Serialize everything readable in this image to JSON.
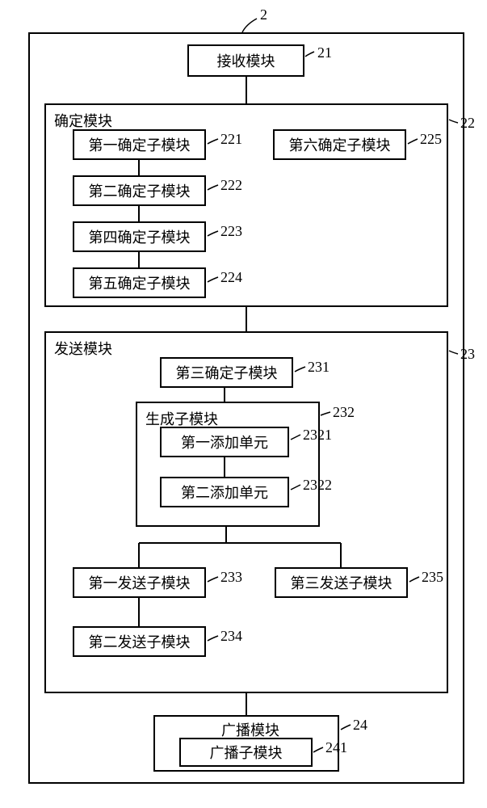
{
  "system": {
    "id": "2"
  },
  "receive": {
    "id": "21",
    "label": "接收模块"
  },
  "determine": {
    "id": "22",
    "title": "确定模块",
    "sub1": {
      "id": "221",
      "label": "第一确定子模块"
    },
    "sub2": {
      "id": "222",
      "label": "第二确定子模块"
    },
    "sub4": {
      "id": "223",
      "label": "第四确定子模块"
    },
    "sub5": {
      "id": "224",
      "label": "第五确定子模块"
    },
    "sub6": {
      "id": "225",
      "label": "第六确定子模块"
    }
  },
  "send": {
    "id": "23",
    "title": "发送模块",
    "sub3": {
      "id": "231",
      "label": "第三确定子模块"
    },
    "gen": {
      "id": "232",
      "title": "生成子模块",
      "unit1": {
        "id": "2321",
        "label": "第一添加单元"
      },
      "unit2": {
        "id": "2322",
        "label": "第二添加单元"
      }
    },
    "send1": {
      "id": "233",
      "label": "第一发送子模块"
    },
    "send2": {
      "id": "234",
      "label": "第二发送子模块"
    },
    "send3": {
      "id": "235",
      "label": "第三发送子模块"
    }
  },
  "broadcast": {
    "id": "24",
    "title": "广播模块",
    "sub": {
      "id": "241",
      "label": "广播子模块"
    }
  }
}
